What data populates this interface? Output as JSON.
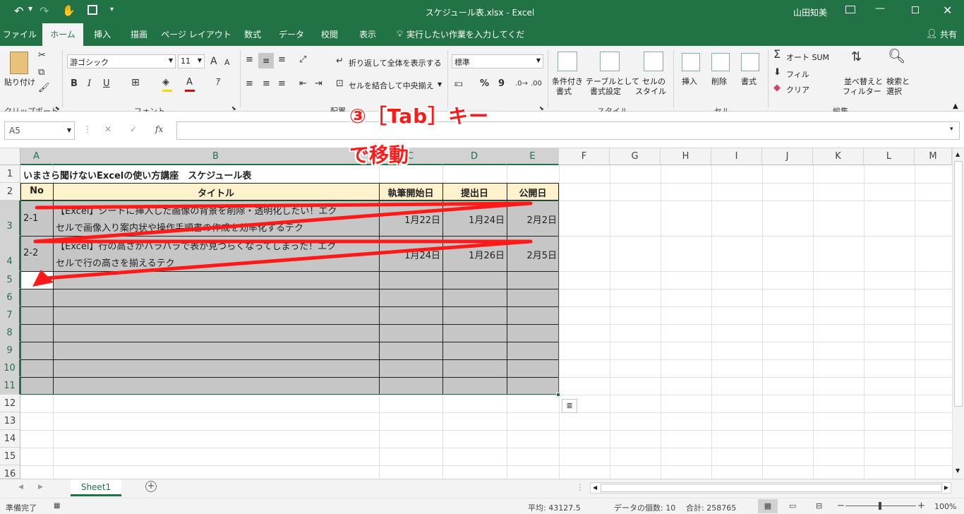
{
  "titlebar": {
    "title": "スケジュール表.xlsx  -  Excel",
    "user": "山田知美"
  },
  "tabs": [
    "ファイル",
    "ホーム",
    "挿入",
    "描画",
    "ページ レイアウト",
    "数式",
    "データ",
    "校閲",
    "表示"
  ],
  "tell_me": "実行したい作業を入力してください",
  "share": "共有",
  "ribbon": {
    "clipboard": {
      "paste": "貼り付け",
      "group": "クリップボード"
    },
    "font": {
      "name": "游ゴシック",
      "size": "11",
      "bold": "B",
      "italic": "I",
      "underline": "U",
      "grow": "A",
      "shrink": "A",
      "color_letter": "A",
      "group": "フォント"
    },
    "alignment": {
      "wrap": "折り返して全体を表示する",
      "merge": "セルを結合して中央揃え",
      "group": "配置"
    },
    "number": {
      "format": "標準",
      "percent": "%",
      "comma": "9",
      "group": "数値"
    },
    "styles": {
      "cond": [
        "条件付き",
        "書式"
      ],
      "table": [
        "テーブルとして",
        "書式設定"
      ],
      "cell": [
        "セルの",
        "スタイル"
      ],
      "group": "スタイル"
    },
    "cells": {
      "insert": "挿入",
      "delete": "削除",
      "format": "書式",
      "group": "セル"
    },
    "editing": {
      "autosum": "オート SUM",
      "fill": "フィル",
      "clear": "クリア",
      "sort": [
        "並べ替えと",
        "フィルター"
      ],
      "find": [
        "検索と",
        "選択"
      ],
      "group": "編集"
    }
  },
  "formula_bar": {
    "name_box": "A5",
    "fx": "fx",
    "content": ""
  },
  "columns": [
    "A",
    "B",
    "C",
    "D",
    "E",
    "F",
    "G",
    "H",
    "I",
    "J",
    "K",
    "L",
    "M"
  ],
  "rows": [
    "1",
    "2",
    "3",
    "4",
    "5",
    "6",
    "7",
    "8",
    "9",
    "10",
    "11",
    "12",
    "13",
    "14",
    "15",
    "16"
  ],
  "sheet": {
    "title": "いまさら聞けないExcelの使い方講座　スケジュール表",
    "headers": [
      "No",
      "タイトル",
      "執筆開始日",
      "提出日",
      "公開日"
    ],
    "data": [
      {
        "no": "2-1",
        "title1": "【Excel】シートに挿入した画像の背景を削除・透明化したい！エク",
        "title2": "セルで画像入り案内状や操作手順書の作成を効率化するテク",
        "start": "1月22日",
        "submit": "1月24日",
        "publish": "2月2日"
      },
      {
        "no": "2-2",
        "title1": "【Excel】行の高さがバラバラで表が見づらくなってしまった！エク",
        "title2": "セルで行の高さを揃えるテク",
        "start": "1月24日",
        "submit": "1月26日",
        "publish": "2月5日"
      }
    ]
  },
  "annotation": {
    "line1": "③［Tab］キー",
    "line2": "で移動",
    "color": "#ff1a1a"
  },
  "sheet_tab": "Sheet1",
  "status": {
    "ready": "準備完了",
    "average": "平均: 43127.5",
    "count": "データの個数: 10",
    "sum": "合計: 258765",
    "zoom": "100%"
  },
  "colors": {
    "excel_green": "#217346",
    "header_fill": "#fff2cc",
    "selection_fill": "#c6c6c6"
  }
}
